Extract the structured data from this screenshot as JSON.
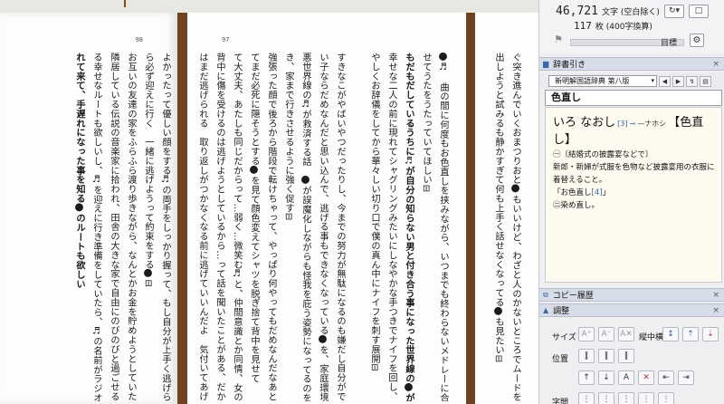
{
  "pages": {
    "left": {
      "page_number": "98",
      "columns": [
        {
          "text": "よかったって優しい顔をする♬の両手をしっかり握って、もし自分が上手く逃げられたら",
          "bold": false
        },
        {
          "text": "ら必ず迎えに行く　一緒に逃げようって約束をする🌑⊟",
          "bold": false
        },
        {
          "text": "お互いの友達の家をふらふら渡り歩きながら、なんとかお金を貯めようとしていたら、",
          "bold": false
        },
        {
          "text": "隣居している伝説の音楽家に拾われ、田舎の大きな家で自由にのびのびと過ごせるように",
          "bold": false
        },
        {
          "text": "る幸せなルートも欲しいし、♬を迎えに行き準備をしていたら、♬の名前がラジオから流",
          "bold": false
        },
        {
          "text": "れて来て、手遅れになった事を知る🌑のルートも欲しい",
          "bold": true
        }
      ]
    },
    "middle": {
      "page_number": "97",
      "columns": [
        {
          "text": "🌑♬　曲の間に何度もお色直しを挟みながら、いつまでも終わらないメドレーに合わ",
          "bold": false
        },
        {
          "text": "せてうたをうたっていてほしい⊟",
          "bold": false
        },
        {
          "text": "もだもだしているうちに♬が自分の知らない男と付き合う事になった世界線の🌑が、",
          "bold": true
        },
        {
          "text": "幸せな二人の前に現れてシャグリングみたいにしなやかな手つきでナイフを回し、うやう",
          "bold": false
        },
        {
          "text": "やしくお辞儀をしてから華々しい切り口で僕の真ん中にナイフを刺す展開⊟",
          "bold": false
        },
        {
          "text": "",
          "bold": false
        },
        {
          "text": "すきなこがやばいやつだったりし、今までの努力が無駄になるのも嫌だし自分ができな",
          "bold": false
        },
        {
          "text": "い子ならだめなんだと思い込んで、逃げる事もできなくなっている🌑を、家庭環境劣",
          "bold": false
        },
        {
          "text": "悪世界線の♬が救済する話　🌑が誤魔化しながらも怪我を庇う姿勢になってるのを見抜",
          "bold": false
        },
        {
          "text": "き、家まで行きさせるように強く促す⊟",
          "bold": false
        },
        {
          "text": "強張った顔で後ろから階段で転けちゃって、やっぱり何やってもだめなんだなあと自棄",
          "bold": false
        },
        {
          "text": "てまだ必死に隠そうとする🌑を見て顔色変えてシャツを脱ぎ捨て背中を見せて",
          "bold": false
        },
        {
          "text": "て大丈夫、あたしも同じだからって…弱く…微笑む♬と、仲間意識とか同情、女の子",
          "bold": false
        },
        {
          "text": "背中に傷を受けるのは逃げようとしているから…って話を聞いたことがある、だから",
          "bold": false
        },
        {
          "text": "はまだ逃げられる　取り返しがつかなくなる前に逃げていいんだよ　気付いてあげられて",
          "bold": false
        }
      ]
    },
    "right": {
      "columns": [
        {
          "text": "ぐ突き進んでいくおまつりおと🌑もいいけど、わざと人のかないところでムードを演",
          "bold": false
        },
        {
          "text": "出しようと試みるも静かすぎて何も上手く話せなくなってる🌑も見たい⊟",
          "bold": false
        }
      ]
    }
  },
  "sidebar": {
    "char_count": "46,721",
    "char_count_label": "文字 (空白除く)",
    "sheet_count": "117",
    "sheet_count_label": "枚 (400字換算)",
    "refresh_icon": "↻▾",
    "box_icon": "□",
    "goal_label": "目標",
    "goal_progress": 0.0,
    "dictionary": {
      "panel_title": "辞書引き",
      "selected_dictionary": "新明解国語辞典 第八版",
      "search_value": "色直し",
      "entry": {
        "reading": "いろ なおし",
        "num": "[3]",
        "link": "⊸",
        "accent": "—ナホシ",
        "headword": "【色直",
        "headword_cont": "し】",
        "def1": "㊀〔結婚式の披露宴などで〕",
        "def2": "新郎・新婦が式服を色物など披露宴用の衣服に着替えること。",
        "example": "「お色直し",
        "example_num": "[4]",
        "example_end": "」",
        "def3": "㊁染め直し。"
      }
    },
    "copy_history_title": "コピー履歴",
    "adjust": {
      "title": "調整",
      "size_label": "サイズ",
      "vertical_label": "縦中横",
      "position_label": "位置",
      "spacing_label": "字間"
    }
  }
}
